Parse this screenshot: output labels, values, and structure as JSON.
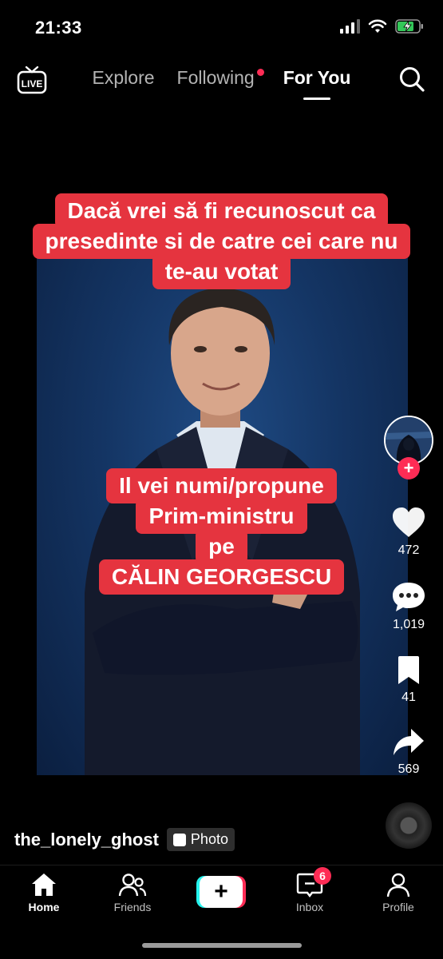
{
  "status_bar": {
    "time": "21:33"
  },
  "top_nav": {
    "tabs": [
      {
        "label": "Explore"
      },
      {
        "label": "Following"
      },
      {
        "label": "For You"
      }
    ],
    "live_label": "LIVE"
  },
  "caption_top": {
    "lines": [
      "Dacă vrei să fi recunoscut ca",
      "presedinte si de catre cei care nu",
      "te-au votat"
    ]
  },
  "caption_mid": {
    "lines": [
      "Il vei numi/propune",
      "Prim-ministru",
      "pe",
      "CĂLIN GEORGESCU"
    ]
  },
  "actions": {
    "likes": "472",
    "comments": "1,019",
    "saves": "41",
    "shares": "569"
  },
  "post": {
    "username": "the_lonely_ghost",
    "badge": "Photo"
  },
  "bottom_nav": {
    "home": "Home",
    "friends": "Friends",
    "inbox": "Inbox",
    "inbox_badge": "6",
    "profile": "Profile"
  },
  "colors": {
    "accent": "#fe2c55",
    "caption_bg": "#e5343f",
    "cyan": "#25f4ee"
  }
}
